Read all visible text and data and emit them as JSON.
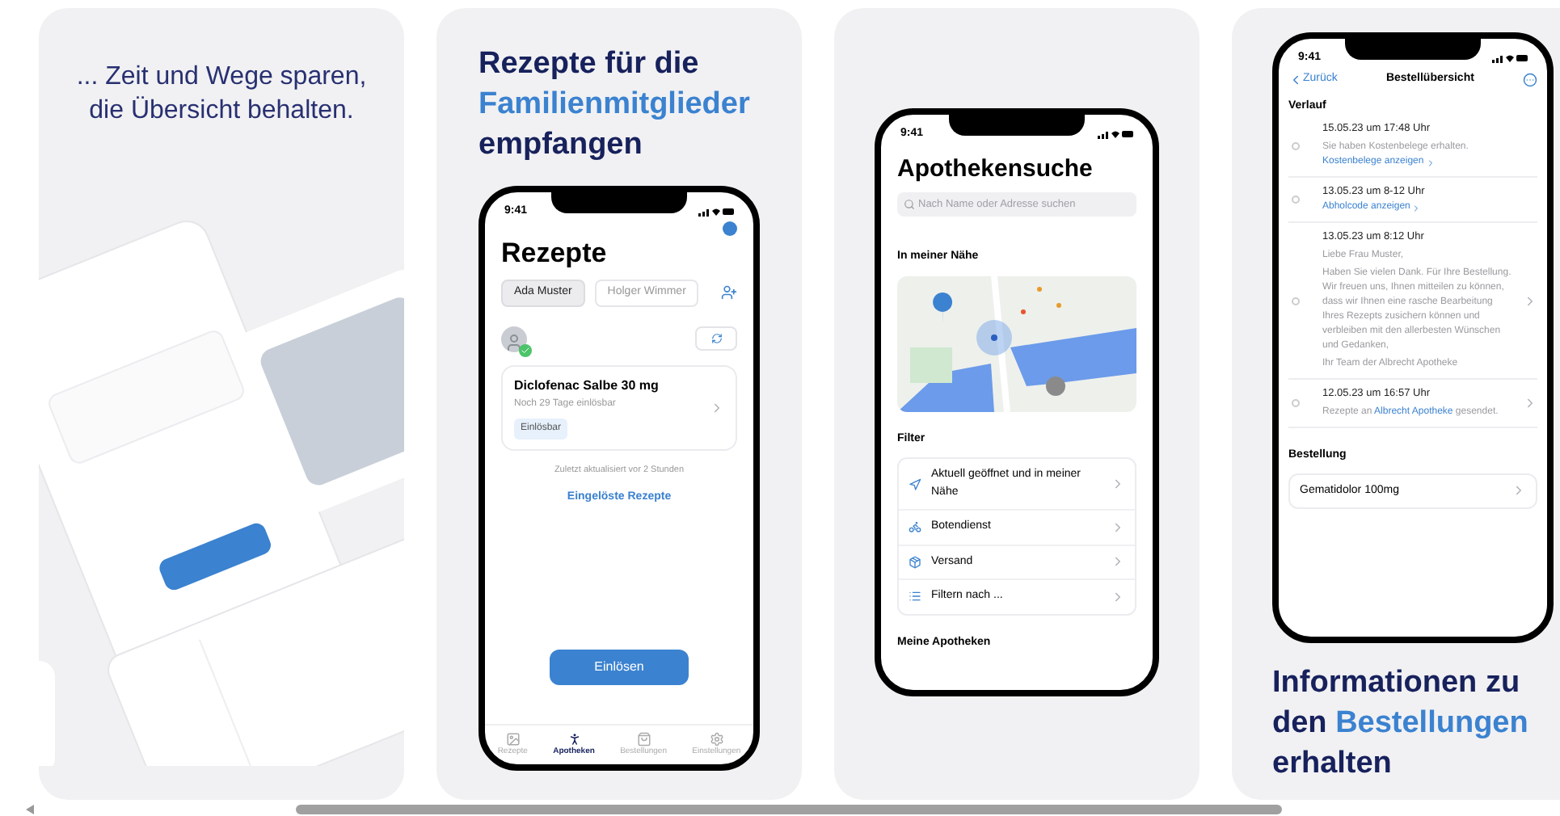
{
  "gallery": [
    {
      "kind": "collage",
      "heading": [
        [
          {
            "text": "... Zeit und Wege sparen,",
            "accent": false
          }
        ],
        [
          {
            "text": "die Übersicht behalten.",
            "accent": false
          }
        ]
      ]
    },
    {
      "kind": "prescriptions",
      "heading": [
        [
          {
            "text": "Rezepte für die",
            "accent": false
          }
        ],
        [
          {
            "text": "Familienmitglieder",
            "accent": true
          }
        ],
        [
          {
            "text": "empfangen",
            "accent": false
          }
        ]
      ],
      "screen": {
        "time": "9:41",
        "title": "Rezepte",
        "profiles": [
          {
            "label": "Ada Muster",
            "selected": true
          },
          {
            "label": "Holger Wimmer",
            "selected": false
          }
        ],
        "prescription": {
          "name": "Diclofenac Salbe 30 mg",
          "validity": "Noch 29 Tage einlösbar",
          "status": "Einlösbar"
        },
        "updated": "Zuletzt aktualisiert vor 2 Stunden",
        "link": "Eingelöste Rezepte",
        "action": "Einlösen",
        "tabbar": [
          {
            "label": "Rezepte",
            "selected": false
          },
          {
            "label": "Apotheken",
            "selected": true
          },
          {
            "label": "Bestellungen",
            "selected": false
          },
          {
            "label": "Einstellungen",
            "selected": false
          }
        ]
      }
    },
    {
      "kind": "pharmacy_search",
      "screen": {
        "time": "9:41",
        "title": "Apothekensuche",
        "search_placeholder": "Nach Name oder Adresse suchen",
        "nearby_heading": "In meiner Nähe",
        "filter_heading": "Filter",
        "filters": [
          "Aktuell geöffnet und in meiner Nähe",
          "Botendienst",
          "Versand",
          "Filtern nach ..."
        ],
        "my_heading": "Meine Apotheken"
      }
    },
    {
      "kind": "order_overview",
      "heading": [
        [
          {
            "text": "Informationen zu",
            "accent": false
          }
        ],
        [
          {
            "text": "den",
            "accent": false
          },
          {
            "text": "Bestellungen",
            "accent": true
          }
        ],
        [
          {
            "text": "erhalten",
            "accent": false
          }
        ]
      ],
      "screen": {
        "time": "9:41",
        "back": "Zurück",
        "title": "Bestellübersicht",
        "history_heading": "Verlauf",
        "events": [
          {
            "date": "15.05.23 um 17:48 Uhr",
            "paragraphs": [
              [
                {
                  "text": "Sie haben Kostenbelege erhalten.",
                  "link": false
                }
              ]
            ],
            "link": "Kostenbelege anzeigen",
            "expandable": false
          },
          {
            "date": "13.05.23 um 8-12 Uhr",
            "link": "Abholcode anzeigen",
            "expandable": false
          },
          {
            "date": "13.05.23 um 8:12 Uhr",
            "paragraphs": [
              [
                {
                  "text": "Liebe Frau Muster,",
                  "link": false
                }
              ],
              [
                {
                  "text": "Haben Sie vielen Dank. Für Ihre Bestellung. Wir freuen uns, Ihnen mitteilen zu können, dass wir Ihnen eine rasche Bearbeitung Ihres Rezepts zusichern können und verbleiben mit den allerbesten Wünschen und Gedanken,",
                  "link": false
                }
              ],
              [
                {
                  "text": "Ihr Team der Albrecht Apotheke",
                  "link": false
                }
              ]
            ],
            "expandable": true
          },
          {
            "date": "12.05.23 um 16:57 Uhr",
            "paragraphs": [
              [
                {
                  "text": "Rezepte an",
                  "link": false
                },
                {
                  "text": "Albrecht Apotheke",
                  "link": true
                },
                {
                  "text": "gesendet.",
                  "link": false
                }
              ]
            ],
            "expandable": true
          }
        ],
        "order_heading": "Bestellung",
        "items": [
          "Gematidolor 100mg"
        ]
      }
    }
  ]
}
